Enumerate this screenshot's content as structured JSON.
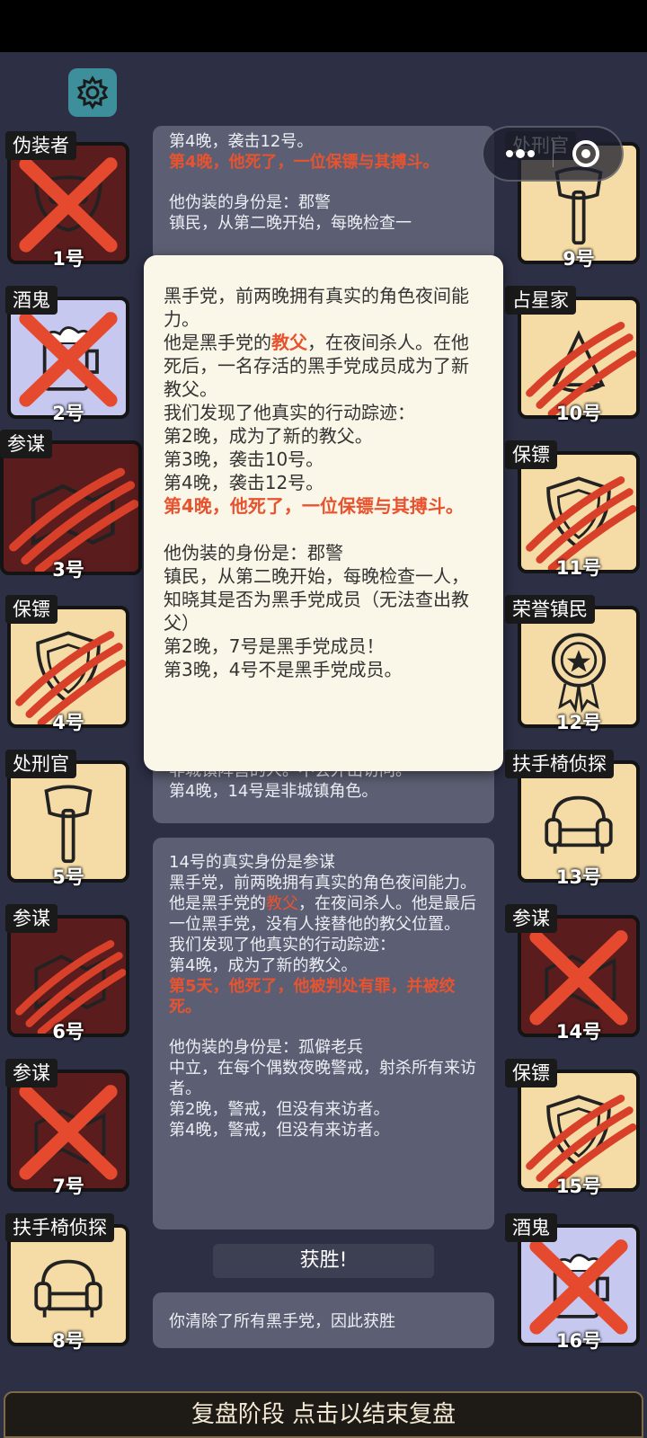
{
  "players": [
    {
      "num": "1号",
      "role": "伪装者",
      "state": "dead"
    },
    {
      "num": "2号",
      "role": "酒鬼",
      "state": "dead"
    },
    {
      "num": "3号",
      "role": "参谋",
      "state": "attacked"
    },
    {
      "num": "4号",
      "role": "保镖",
      "state": "attacked"
    },
    {
      "num": "5号",
      "role": "处刑官",
      "state": "alive"
    },
    {
      "num": "6号",
      "role": "参谋",
      "state": "attacked"
    },
    {
      "num": "7号",
      "role": "参谋",
      "state": "dead"
    },
    {
      "num": "8号",
      "role": "扶手椅侦探",
      "state": "alive"
    },
    {
      "num": "9号",
      "role": "处刑官",
      "state": "alive"
    },
    {
      "num": "10号",
      "role": "占星家",
      "state": "attacked"
    },
    {
      "num": "11号",
      "role": "保镖",
      "state": "attacked"
    },
    {
      "num": "12号",
      "role": "荣誉镇民",
      "state": "alive"
    },
    {
      "num": "13号",
      "role": "扶手椅侦探",
      "state": "alive"
    },
    {
      "num": "14号",
      "role": "参谋",
      "state": "dead"
    },
    {
      "num": "15号",
      "role": "保镖",
      "state": "attacked"
    },
    {
      "num": "16号",
      "role": "酒鬼",
      "state": "dead"
    }
  ],
  "log_top": {
    "l1": "第4晚，袭击12号。",
    "l2": "第4晚，他死了，一位保镖与其搏斗。",
    "l3": "他伪装的身份是：郡警",
    "l4": "镇民，从第二晚开始，每晚检查一"
  },
  "log_mid": {
    "l1": "非城镇阵营的人。不会外出访问。",
    "l2": "第4晚，14号是非城镇角色。"
  },
  "log_main": {
    "l1": "14号的真实身份是参谋",
    "l2": "黑手党，前两晚拥有真实的角色夜间能力。",
    "l3a": "他是黑手党的",
    "l3b": "教父",
    "l3c": "，在夜间杀人。他是最后一位黑手党，没有人接替他的教父位置。",
    "l4": "我们发现了他真实的行动踪迹：",
    "l5": "第4晚，成为了新的教父。",
    "l6": "第5天，他死了，他被判处有罪，并被绞死。",
    "l7": "他伪装的身份是：孤僻老兵",
    "l8": "中立，在每个偶数夜晚警戒，射杀所有来访者。",
    "l9": "第2晚，警戒，但没有来访者。",
    "l10": "第4晚，警戒，但没有来访者。"
  },
  "win_label": "获胜!",
  "win_text": "你清除了所有黑手党，因此获胜",
  "popup": {
    "l1": "黑手党，前两晚拥有真实的角色夜间能力。",
    "l2a": "他是黑手党的",
    "l2b": "教父",
    "l2c": "，在夜间杀人。在他死后，一名存活的黑手党成员成为了新教父。",
    "l3": "我们发现了他真实的行动踪迹：",
    "l4": "第2晚，成为了新的教父。",
    "l5": "第3晚，袭击10号。",
    "l6": "第4晚，袭击12号。",
    "l7": "第4晚，他死了，一位保镖与其搏斗。",
    "l8": "他伪装的身份是：郡警",
    "l9": "镇民，从第二晚开始，每晚检查一人，知晓其是否为黑手党成员（无法查出教父）",
    "l10": "第2晚，7号是黑手党成员！",
    "l11": "第3晚，4号不是黑手党成员。"
  },
  "bottom_bar": "复盘阶段 点击以结束复盘",
  "colors": {
    "accent_red": "#e8532f",
    "card_cream": "#f5dca6",
    "card_dark_red": "#5a1c1c",
    "settings_teal": "#3e8f9c"
  }
}
